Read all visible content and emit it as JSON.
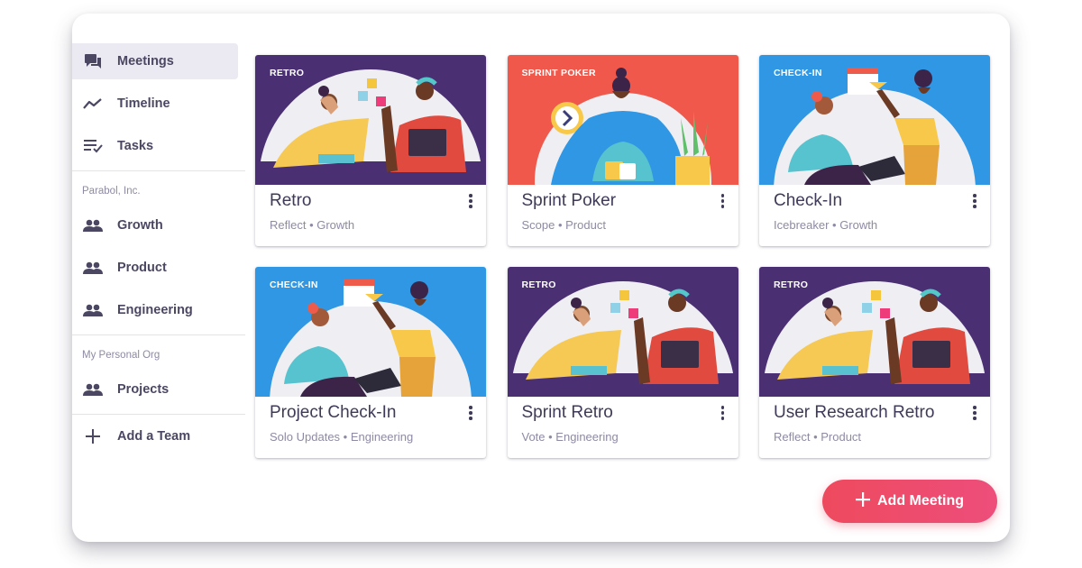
{
  "sidebar": {
    "items": [
      {
        "label": "Meetings",
        "icon": "forum-icon",
        "active": true
      },
      {
        "label": "Timeline",
        "icon": "timeline-icon"
      },
      {
        "label": "Tasks",
        "icon": "tasks-icon"
      }
    ],
    "orgs": [
      {
        "name": "Parabol, Inc.",
        "teams": [
          "Growth",
          "Product",
          "Engineering"
        ]
      },
      {
        "name": "My Personal Org",
        "teams": [
          "Projects"
        ]
      }
    ],
    "add_team_label": "Add a Team"
  },
  "cards": [
    {
      "tag": "RETRO",
      "title": "Retro",
      "subtitle": "Reflect • Growth",
      "art": "retro",
      "color": "#4a2f73"
    },
    {
      "tag": "SPRINT POKER",
      "title": "Sprint Poker",
      "subtitle": "Scope • Product",
      "art": "poker",
      "color": "#f0584b"
    },
    {
      "tag": "CHECK-IN",
      "title": "Check-In",
      "subtitle": "Icebreaker • Growth",
      "art": "checkin",
      "color": "#2f97e3"
    },
    {
      "tag": "CHECK-IN",
      "title": "Project Check-In",
      "subtitle": "Solo Updates • Engineering",
      "art": "checkin",
      "color": "#2f97e3"
    },
    {
      "tag": "RETRO",
      "title": "Sprint Retro",
      "subtitle": "Vote • Engineering",
      "art": "retro",
      "color": "#4a2f73"
    },
    {
      "tag": "RETRO",
      "title": "User Research Retro",
      "subtitle": "Reflect • Product",
      "art": "retro",
      "color": "#4a2f73"
    }
  ],
  "fab": {
    "label": "Add Meeting",
    "icon": "plus-icon"
  },
  "colors": {
    "accent": "#ee4a5e",
    "sidebar_active": "#ebe9f1",
    "text": "#4b4763"
  }
}
